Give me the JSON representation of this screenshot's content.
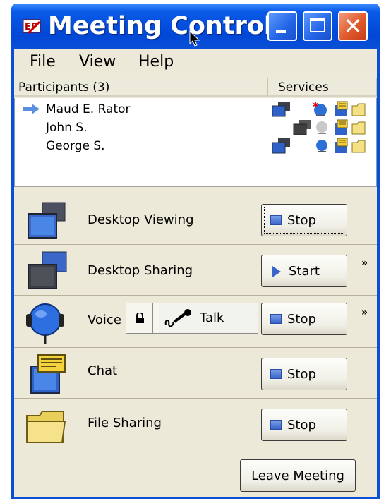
{
  "window": {
    "title": "Meeting Control",
    "controls": {
      "minimize": "minimize",
      "maximize": "maximize",
      "close": "✕"
    }
  },
  "menu": {
    "items": [
      "File",
      "View",
      "Help"
    ]
  },
  "list": {
    "headers": {
      "participants": "Participants (3)",
      "services": "Services"
    },
    "participants": [
      {
        "name": "Maud E. Rator",
        "presenter": true
      },
      {
        "name": "John S.",
        "presenter": false
      },
      {
        "name": "George S.",
        "presenter": false
      }
    ]
  },
  "features": {
    "desktop_viewing": {
      "label": "Desktop Viewing",
      "button": "Stop",
      "icon": "monitor-icon"
    },
    "desktop_sharing": {
      "label": "Desktop Sharing",
      "button": "Start",
      "expand": "»",
      "icon": "monitor-icon"
    },
    "voice": {
      "label": "Voice",
      "talk": "Talk",
      "button": "Stop",
      "expand": "»",
      "icon": "headset-icon"
    },
    "chat": {
      "label": "Chat",
      "button": "Stop",
      "icon": "chat-icon"
    },
    "file_sharing": {
      "label": "File Sharing",
      "button": "Stop",
      "icon": "folder-icon"
    }
  },
  "footer": {
    "leave": "Leave Meeting"
  },
  "colors": {
    "titlebar": "#0a4fd6",
    "face": "#ece9d8",
    "accent": "#2e5fd0"
  }
}
